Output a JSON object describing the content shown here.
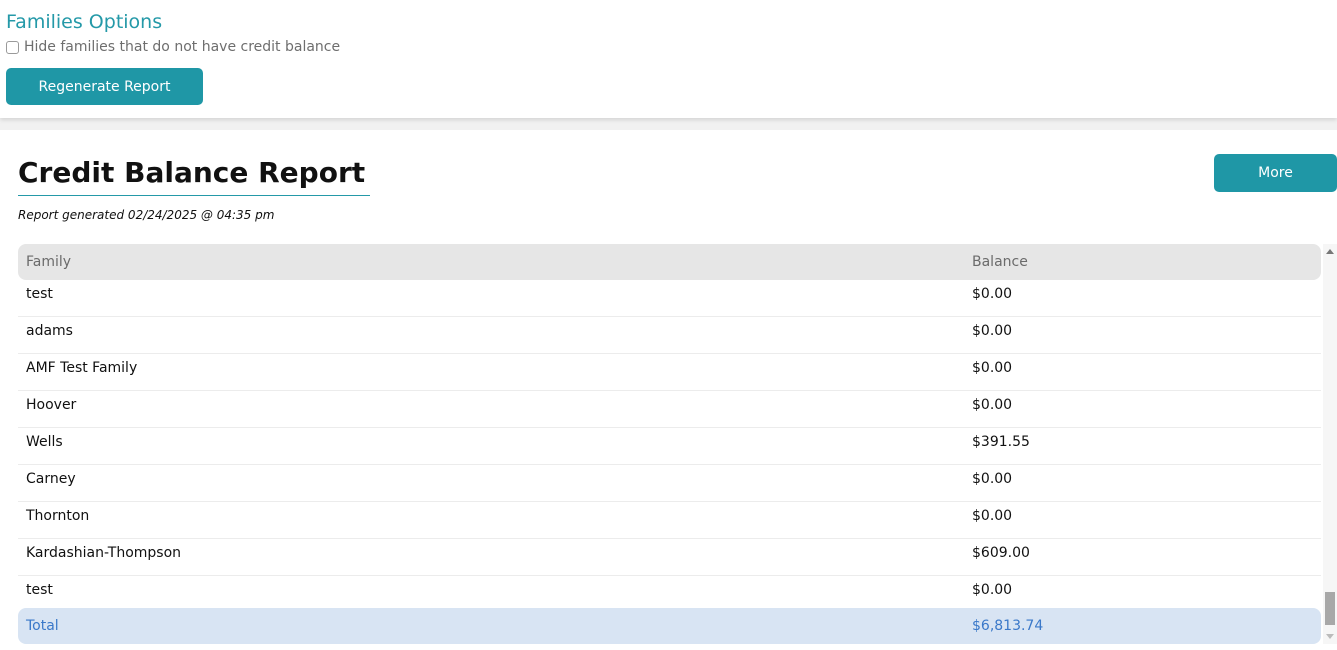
{
  "options": {
    "title": "Families Options",
    "hide_checkbox_label": "Hide families that do not have credit balance",
    "hide_checkbox_checked": false,
    "regenerate_label": "Regenerate Report"
  },
  "report": {
    "title": "Credit Balance Report",
    "generated": "Report generated 02/24/2025 @ 04:35 pm",
    "more_label": "More"
  },
  "table": {
    "headers": {
      "family": "Family",
      "balance": "Balance"
    },
    "rows": [
      {
        "family": "test",
        "balance": "$0.00"
      },
      {
        "family": "adams",
        "balance": "$0.00"
      },
      {
        "family": "AMF Test Family",
        "balance": "$0.00"
      },
      {
        "family": "Hoover",
        "balance": "$0.00"
      },
      {
        "family": "Wells",
        "balance": "$391.55"
      },
      {
        "family": "Carney",
        "balance": "$0.00"
      },
      {
        "family": "Thornton",
        "balance": "$0.00"
      },
      {
        "family": "Kardashian-Thompson",
        "balance": "$609.00"
      },
      {
        "family": "test",
        "balance": "$0.00"
      }
    ],
    "total": {
      "label": "Total",
      "value": "$6,813.74"
    }
  },
  "colors": {
    "accent": "#1f97a6",
    "total_bg": "#d8e4f3",
    "total_text": "#3a78c9"
  }
}
